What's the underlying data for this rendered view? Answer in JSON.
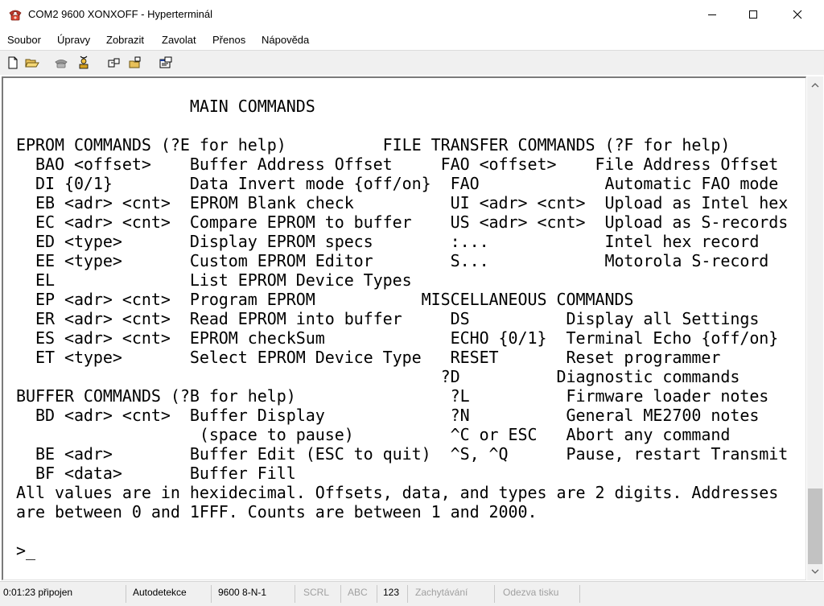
{
  "window": {
    "title": "COM2 9600 XONXOFF - Hyperterminál",
    "icon": "hyperterminal-phone-icon"
  },
  "window_controls": [
    "minimize-icon",
    "maximize-icon",
    "close-icon"
  ],
  "menu": [
    {
      "label": "Soubor"
    },
    {
      "label": "Úpravy"
    },
    {
      "label": "Zobrazit"
    },
    {
      "label": "Zavolat"
    },
    {
      "label": "Přenos"
    },
    {
      "label": "Nápověda"
    }
  ],
  "toolbar_icons": [
    "new-icon",
    "open-icon",
    "connect-icon",
    "disconnect-icon",
    "send-icon",
    "receive-icon",
    "properties-icon"
  ],
  "terminal": {
    "lines": [
      "                  MAIN COMMANDS",
      "",
      "EPROM COMMANDS (?E for help)          FILE TRANSFER COMMANDS (?F for help)",
      "  BAO <offset>    Buffer Address Offset     FAO <offset>    File Address Offset",
      "  DI {0/1}        Data Invert mode {off/on}  FAO             Automatic FAO mode",
      "  EB <adr> <cnt>  EPROM Blank check          UI <adr> <cnt>  Upload as Intel hex",
      "  EC <adr> <cnt>  Compare EPROM to buffer    US <adr> <cnt>  Upload as S-records",
      "  ED <type>       Display EPROM specs        :...            Intel hex record",
      "  EE <type>       Custom EPROM Editor        S...            Motorola S-record",
      "  EL              List EPROM Device Types",
      "  EP <adr> <cnt>  Program EPROM           MISCELLANEOUS COMMANDS",
      "  ER <adr> <cnt>  Read EPROM into buffer     DS          Display all Settings",
      "  ES <adr> <cnt>  EPROM checkSum             ECHO {0/1}  Terminal Echo {off/on}",
      "  ET <type>       Select EPROM Device Type   RESET       Reset programmer",
      "                                            ?D          Diagnostic commands",
      "BUFFER COMMANDS (?B for help)                ?L          Firmware loader notes",
      "  BD <adr> <cnt>  Buffer Display             ?N          General ME2700 notes",
      "                   (space to pause)          ^C or ESC   Abort any command",
      "  BE <adr>        Buffer Edit (ESC to quit)  ^S, ^Q      Pause, restart Transmit",
      "  BF <data>       Buffer Fill",
      "All values are in hexidecimal. Offsets, data, and types are 2 digits. Addresses",
      "are between 0 and 1FFF. Counts are between 1 and 2000.",
      "",
      ">_"
    ]
  },
  "statusbar": {
    "connected_time": "0:01:23 připojen",
    "detect": "Autodetekce",
    "settings": "9600 8-N-1",
    "scrl": "SCRL",
    "abc": "ABC",
    "num": "123",
    "capture": "Zachytávání",
    "print_echo": "Odezva tisku"
  }
}
